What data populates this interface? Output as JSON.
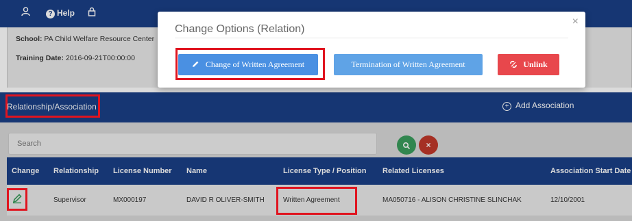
{
  "topbar": {
    "user_icon": "user-icon",
    "help_label": "Help",
    "lock_icon": "lock-icon"
  },
  "info": {
    "school_label": "School:",
    "school_value": "PA Child Welfare Resource Center",
    "training_label": "Training Date:",
    "training_value": "2016-09-21T00:00:00"
  },
  "section": {
    "title": "Relationship/Association",
    "add_label": "Add Association"
  },
  "search": {
    "placeholder": "Search"
  },
  "table": {
    "headers": [
      "Change",
      "Relationship",
      "License Number",
      "Name",
      "License Type / Position",
      "Related Licenses",
      "Association Start Date"
    ],
    "row": {
      "change_icon": "edit-icon",
      "relationship": "Supervisor",
      "license_number": "MX000197",
      "name": "DAVID R OLIVER-SMITH",
      "license_type": "Written Agreement",
      "related_licenses": "MA050716 - ALISON CHRISTINE SLINCHAK",
      "start_date": "12/10/2001"
    }
  },
  "modal": {
    "title": "Change Options (Relation)",
    "change_btn": "Change of Written Agreement",
    "termination_btn": "Termination of Written Agreement",
    "unlink_btn": "Unlink"
  },
  "colors": {
    "brand_blue": "#1a3f86",
    "primary_button": "#4a90e2",
    "button_light": "#5fa3e6",
    "danger": "#e8474c",
    "search_green": "#3a9d5d",
    "clear_red": "#c0392b",
    "highlight": "#e0141f"
  }
}
